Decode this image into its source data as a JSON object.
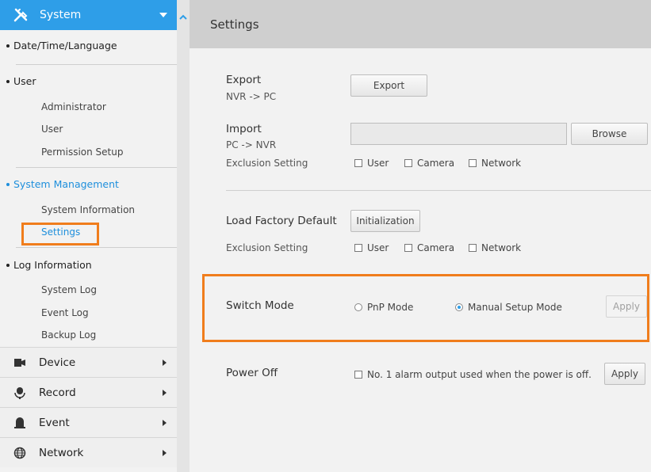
{
  "sidebar": {
    "header_title": "System",
    "groups": {
      "datetime": "Date/Time/Language",
      "user": "User",
      "user_items": [
        "Administrator",
        "User",
        "Permission Setup"
      ],
      "system_management": "System Management",
      "sysman_items": [
        "System Information",
        "Settings"
      ],
      "log": "Log Information",
      "log_items": [
        "System Log",
        "Event Log",
        "Backup Log"
      ]
    },
    "menus": [
      "Device",
      "Record",
      "Event",
      "Network"
    ]
  },
  "main": {
    "title": "Settings",
    "export": {
      "label": "Export",
      "sub": "NVR -> PC",
      "button": "Export"
    },
    "import": {
      "label": "Import",
      "sub": "PC -> NVR",
      "button": "Browse",
      "exclusion_label": "Exclusion Setting",
      "options": [
        "User",
        "Camera",
        "Network"
      ]
    },
    "factory": {
      "label": "Load Factory Default",
      "button": "Initialization",
      "exclusion_label": "Exclusion Setting",
      "options": [
        "User",
        "Camera",
        "Network"
      ]
    },
    "switch_mode": {
      "label": "Switch Mode",
      "options": [
        "PnP Mode",
        "Manual Setup Mode"
      ],
      "selected": "Manual Setup Mode",
      "button": "Apply"
    },
    "power_off": {
      "label": "Power Off",
      "checkbox": "No. 1 alarm output used when the power is off.",
      "button": "Apply"
    }
  },
  "colors": {
    "accent": "#2e9ee8",
    "highlight": "#f07d1c",
    "active_text": "#1e8fdc"
  }
}
